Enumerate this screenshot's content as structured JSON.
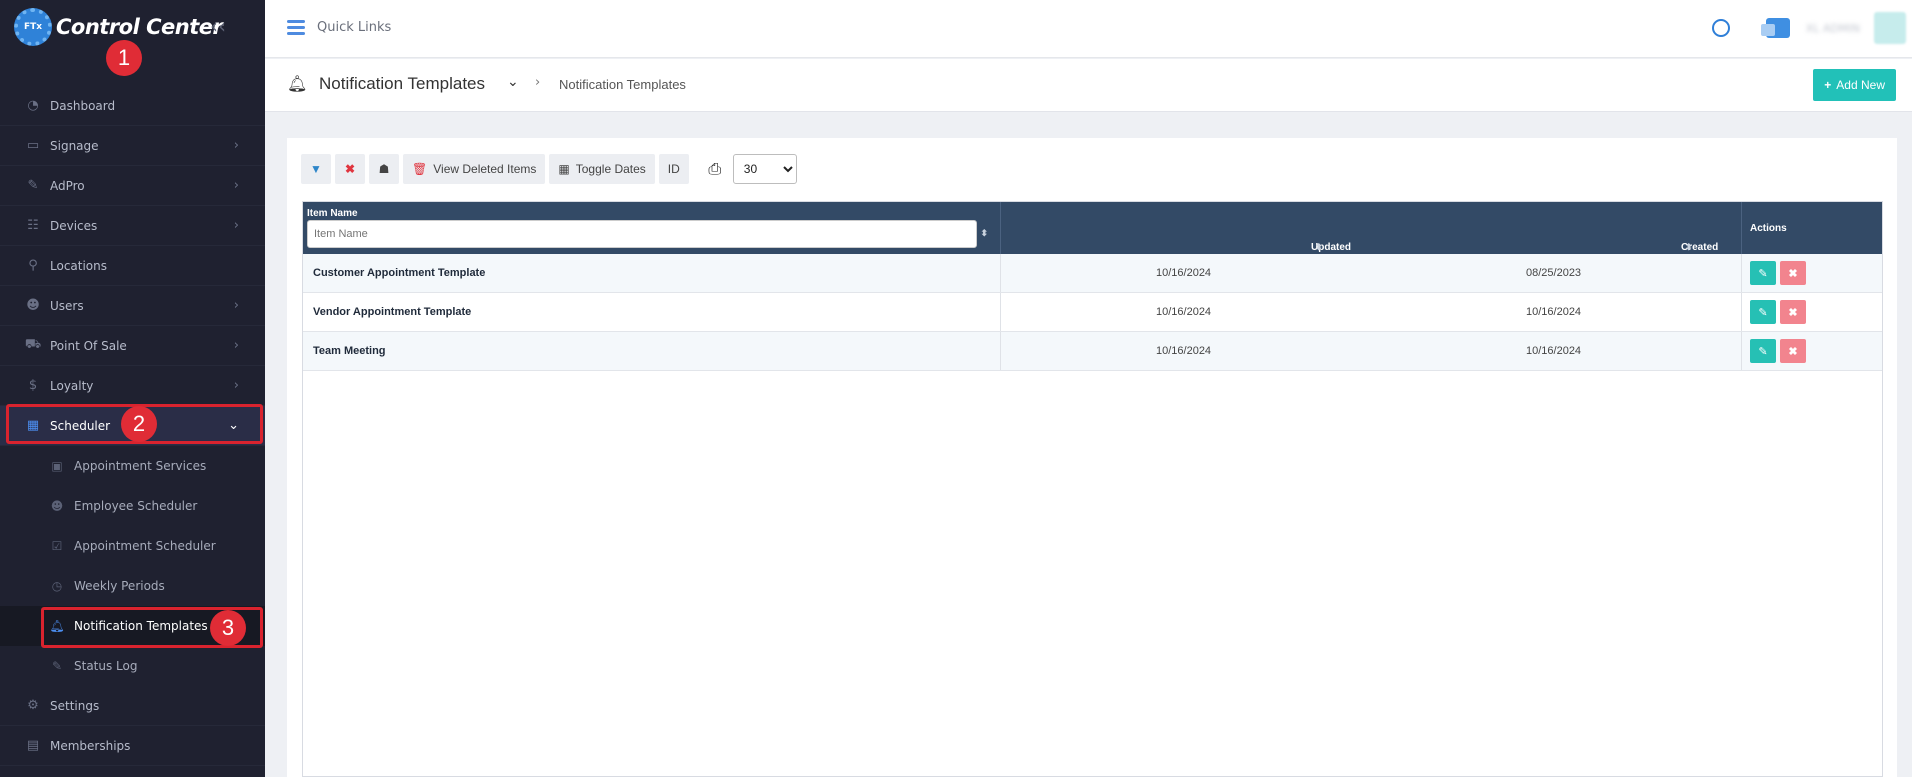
{
  "brand": {
    "name": "Control Center",
    "logo_text": "FTx"
  },
  "sidebar": {
    "items": [
      {
        "label": "Dashboard",
        "icon": "dashboard-icon",
        "glyph": "◔",
        "chevron": false
      },
      {
        "label": "Signage",
        "icon": "monitor-icon",
        "glyph": "▭",
        "chevron": true
      },
      {
        "label": "AdPro",
        "icon": "brush-icon",
        "glyph": "✎",
        "chevron": true
      },
      {
        "label": "Devices",
        "icon": "devices-icon",
        "glyph": "☷",
        "chevron": true
      },
      {
        "label": "Locations",
        "icon": "map-pin-icon",
        "glyph": "⚲",
        "chevron": false
      },
      {
        "label": "Users",
        "icon": "users-icon",
        "glyph": "☻",
        "chevron": true
      },
      {
        "label": "Point Of Sale",
        "icon": "cart-icon",
        "glyph": "⛟",
        "chevron": true
      },
      {
        "label": "Loyalty",
        "icon": "dollar-icon",
        "glyph": "$",
        "chevron": true
      },
      {
        "label": "Scheduler",
        "icon": "calendar-icon",
        "glyph": "▦",
        "chevron": true,
        "active": true
      }
    ],
    "sub_items": [
      {
        "label": "Appointment Services",
        "icon": "calendar-check-icon",
        "glyph": "▣"
      },
      {
        "label": "Employee Scheduler",
        "icon": "user-clock-icon",
        "glyph": "☻"
      },
      {
        "label": "Appointment Scheduler",
        "icon": "calendar-check-icon",
        "glyph": "☑"
      },
      {
        "label": "Weekly Periods",
        "icon": "history-icon",
        "glyph": "◷"
      },
      {
        "label": "Notification Templates",
        "icon": "bell-icon",
        "glyph": "♫",
        "active": true
      },
      {
        "label": "Status Log",
        "icon": "edit-icon",
        "glyph": "✎"
      }
    ],
    "bottom_items": [
      {
        "label": "Settings",
        "icon": "gear-icon",
        "glyph": "⚙"
      },
      {
        "label": "Memberships",
        "icon": "id-card-icon",
        "glyph": "▤"
      }
    ]
  },
  "annotations": {
    "badge1": "1",
    "badge2": "2",
    "badge3": "3"
  },
  "topbar": {
    "quick_links": "Quick Links",
    "user_name": "XL ADMIN"
  },
  "page_header": {
    "title": "Notification Templates",
    "breadcrumb": "Notification Templates",
    "add_button": "Add New"
  },
  "toolbar": {
    "view_deleted": "View Deleted Items",
    "toggle_dates": "Toggle Dates",
    "id": "ID",
    "page_size": "30"
  },
  "table": {
    "headers": {
      "name": "Item Name",
      "updated": "Updated",
      "created": "Created",
      "actions": "Actions"
    },
    "filter_placeholder": "Item Name",
    "rows": [
      {
        "name": "Customer Appointment Template",
        "updated": "10/16/2024",
        "created": "08/25/2023"
      },
      {
        "name": "Vendor Appointment Template",
        "updated": "10/16/2024",
        "created": "10/16/2024"
      },
      {
        "name": "Team Meeting",
        "updated": "10/16/2024",
        "created": "10/16/2024"
      }
    ]
  },
  "colors": {
    "sidebar_bg": "#1f2130",
    "accent_teal": "#22c1b8",
    "delete_pink": "#f2848e",
    "table_header": "#334a66",
    "highlight_red": "#d9232e"
  }
}
